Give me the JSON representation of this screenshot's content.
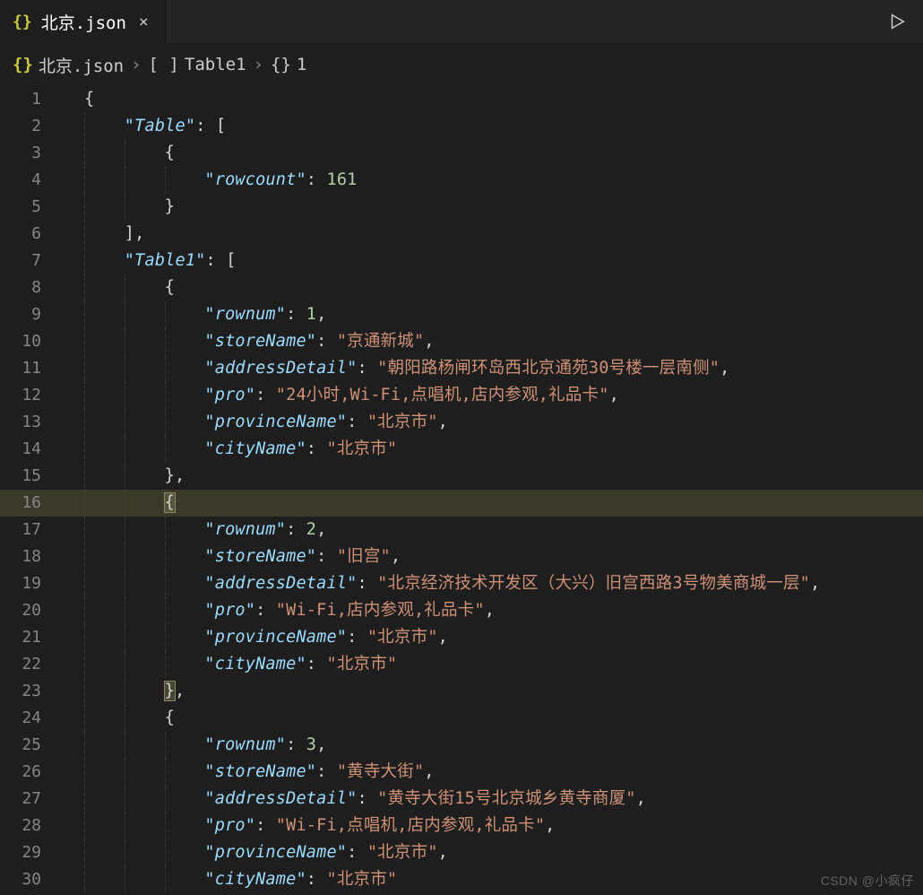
{
  "tab": {
    "file_icon": "{}",
    "filename": "北京.json",
    "close_label": "×"
  },
  "run": {
    "title": "run"
  },
  "breadcrumbs": {
    "file_icon": "{}",
    "file": "北京.json",
    "array_icon": "[ ]",
    "node1": "Table1",
    "object_icon": "{}",
    "node2": "1"
  },
  "code": {
    "indent_unit": 4,
    "lines": [
      {
        "n": 1,
        "indent": 0,
        "guides": [],
        "tokens": [
          {
            "t": "brace",
            "v": "{"
          }
        ]
      },
      {
        "n": 2,
        "indent": 1,
        "guides": [
          0
        ],
        "tokens": [
          {
            "t": "key",
            "v": "Table"
          },
          {
            "t": "punc",
            "v": ": "
          },
          {
            "t": "bracket",
            "v": "["
          }
        ]
      },
      {
        "n": 3,
        "indent": 2,
        "guides": [
          0,
          1
        ],
        "tokens": [
          {
            "t": "brace",
            "v": "{"
          }
        ]
      },
      {
        "n": 4,
        "indent": 3,
        "guides": [
          0,
          1,
          2
        ],
        "tokens": [
          {
            "t": "key",
            "v": "rowcount"
          },
          {
            "t": "punc",
            "v": ": "
          },
          {
            "t": "num",
            "v": "161"
          }
        ]
      },
      {
        "n": 5,
        "indent": 2,
        "guides": [
          0,
          1
        ],
        "tokens": [
          {
            "t": "brace",
            "v": "}"
          }
        ]
      },
      {
        "n": 6,
        "indent": 1,
        "guides": [
          0
        ],
        "tokens": [
          {
            "t": "bracket",
            "v": "]"
          },
          {
            "t": "punc",
            "v": ","
          }
        ]
      },
      {
        "n": 7,
        "indent": 1,
        "guides": [
          0
        ],
        "tokens": [
          {
            "t": "key",
            "v": "Table1"
          },
          {
            "t": "punc",
            "v": ": "
          },
          {
            "t": "bracket",
            "v": "["
          }
        ]
      },
      {
        "n": 8,
        "indent": 2,
        "guides": [
          0,
          1
        ],
        "tokens": [
          {
            "t": "brace",
            "v": "{"
          }
        ]
      },
      {
        "n": 9,
        "indent": 3,
        "guides": [
          0,
          1,
          2
        ],
        "tokens": [
          {
            "t": "key",
            "v": "rownum"
          },
          {
            "t": "punc",
            "v": ": "
          },
          {
            "t": "num",
            "v": "1"
          },
          {
            "t": "punc",
            "v": ","
          }
        ]
      },
      {
        "n": 10,
        "indent": 3,
        "guides": [
          0,
          1,
          2
        ],
        "tokens": [
          {
            "t": "key",
            "v": "storeName"
          },
          {
            "t": "punc",
            "v": ": "
          },
          {
            "t": "str",
            "v": "京通新城"
          },
          {
            "t": "punc",
            "v": ","
          }
        ]
      },
      {
        "n": 11,
        "indent": 3,
        "guides": [
          0,
          1,
          2
        ],
        "tokens": [
          {
            "t": "key",
            "v": "addressDetail"
          },
          {
            "t": "punc",
            "v": ": "
          },
          {
            "t": "str",
            "v": "朝阳路杨闸环岛西北京通苑30号楼一层南侧"
          },
          {
            "t": "punc",
            "v": ","
          }
        ]
      },
      {
        "n": 12,
        "indent": 3,
        "guides": [
          0,
          1,
          2
        ],
        "tokens": [
          {
            "t": "key",
            "v": "pro"
          },
          {
            "t": "punc",
            "v": ": "
          },
          {
            "t": "str",
            "v": "24小时,Wi-Fi,点唱机,店内参观,礼品卡"
          },
          {
            "t": "punc",
            "v": ","
          }
        ]
      },
      {
        "n": 13,
        "indent": 3,
        "guides": [
          0,
          1,
          2
        ],
        "tokens": [
          {
            "t": "key",
            "v": "provinceName"
          },
          {
            "t": "punc",
            "v": ": "
          },
          {
            "t": "str",
            "v": "北京市"
          },
          {
            "t": "punc",
            "v": ","
          }
        ]
      },
      {
        "n": 14,
        "indent": 3,
        "guides": [
          0,
          1,
          2
        ],
        "tokens": [
          {
            "t": "key",
            "v": "cityName"
          },
          {
            "t": "punc",
            "v": ": "
          },
          {
            "t": "str",
            "v": "北京市"
          }
        ]
      },
      {
        "n": 15,
        "indent": 2,
        "guides": [
          0,
          1
        ],
        "tokens": [
          {
            "t": "brace",
            "v": "}"
          },
          {
            "t": "punc",
            "v": ","
          }
        ]
      },
      {
        "n": 16,
        "indent": 2,
        "guides": [
          0,
          1
        ],
        "highlight": true,
        "tokens": [
          {
            "t": "match",
            "v": "{"
          }
        ]
      },
      {
        "n": 17,
        "indent": 3,
        "guides": [
          0,
          1,
          2
        ],
        "tokens": [
          {
            "t": "key",
            "v": "rownum"
          },
          {
            "t": "punc",
            "v": ": "
          },
          {
            "t": "num",
            "v": "2"
          },
          {
            "t": "punc",
            "v": ","
          }
        ]
      },
      {
        "n": 18,
        "indent": 3,
        "guides": [
          0,
          1,
          2
        ],
        "tokens": [
          {
            "t": "key",
            "v": "storeName"
          },
          {
            "t": "punc",
            "v": ": "
          },
          {
            "t": "str",
            "v": "旧宫"
          },
          {
            "t": "punc",
            "v": ","
          }
        ]
      },
      {
        "n": 19,
        "indent": 3,
        "guides": [
          0,
          1,
          2
        ],
        "tokens": [
          {
            "t": "key",
            "v": "addressDetail"
          },
          {
            "t": "punc",
            "v": ": "
          },
          {
            "t": "str",
            "v": "北京经济技术开发区（大兴）旧宫西路3号物美商城一层"
          },
          {
            "t": "punc",
            "v": ","
          }
        ]
      },
      {
        "n": 20,
        "indent": 3,
        "guides": [
          0,
          1,
          2
        ],
        "tokens": [
          {
            "t": "key",
            "v": "pro"
          },
          {
            "t": "punc",
            "v": ": "
          },
          {
            "t": "str",
            "v": "Wi-Fi,店内参观,礼品卡"
          },
          {
            "t": "punc",
            "v": ","
          }
        ]
      },
      {
        "n": 21,
        "indent": 3,
        "guides": [
          0,
          1,
          2
        ],
        "tokens": [
          {
            "t": "key",
            "v": "provinceName"
          },
          {
            "t": "punc",
            "v": ": "
          },
          {
            "t": "str",
            "v": "北京市"
          },
          {
            "t": "punc",
            "v": ","
          }
        ]
      },
      {
        "n": 22,
        "indent": 3,
        "guides": [
          0,
          1,
          2
        ],
        "tokens": [
          {
            "t": "key",
            "v": "cityName"
          },
          {
            "t": "punc",
            "v": ": "
          },
          {
            "t": "str",
            "v": "北京市"
          }
        ]
      },
      {
        "n": 23,
        "indent": 2,
        "guides": [
          0,
          1
        ],
        "tokens": [
          {
            "t": "match",
            "v": "}"
          },
          {
            "t": "punc",
            "v": ","
          }
        ]
      },
      {
        "n": 24,
        "indent": 2,
        "guides": [
          0,
          1
        ],
        "tokens": [
          {
            "t": "brace",
            "v": "{"
          }
        ]
      },
      {
        "n": 25,
        "indent": 3,
        "guides": [
          0,
          1,
          2
        ],
        "tokens": [
          {
            "t": "key",
            "v": "rownum"
          },
          {
            "t": "punc",
            "v": ": "
          },
          {
            "t": "num",
            "v": "3"
          },
          {
            "t": "punc",
            "v": ","
          }
        ]
      },
      {
        "n": 26,
        "indent": 3,
        "guides": [
          0,
          1,
          2
        ],
        "tokens": [
          {
            "t": "key",
            "v": "storeName"
          },
          {
            "t": "punc",
            "v": ": "
          },
          {
            "t": "str",
            "v": "黄寺大街"
          },
          {
            "t": "punc",
            "v": ","
          }
        ]
      },
      {
        "n": 27,
        "indent": 3,
        "guides": [
          0,
          1,
          2
        ],
        "tokens": [
          {
            "t": "key",
            "v": "addressDetail"
          },
          {
            "t": "punc",
            "v": ": "
          },
          {
            "t": "str",
            "v": "黄寺大街15号北京城乡黄寺商厦"
          },
          {
            "t": "punc",
            "v": ","
          }
        ]
      },
      {
        "n": 28,
        "indent": 3,
        "guides": [
          0,
          1,
          2
        ],
        "tokens": [
          {
            "t": "key",
            "v": "pro"
          },
          {
            "t": "punc",
            "v": ": "
          },
          {
            "t": "str",
            "v": "Wi-Fi,点唱机,店内参观,礼品卡"
          },
          {
            "t": "punc",
            "v": ","
          }
        ]
      },
      {
        "n": 29,
        "indent": 3,
        "guides": [
          0,
          1,
          2
        ],
        "tokens": [
          {
            "t": "key",
            "v": "provinceName"
          },
          {
            "t": "punc",
            "v": ": "
          },
          {
            "t": "str",
            "v": "北京市"
          },
          {
            "t": "punc",
            "v": ","
          }
        ]
      },
      {
        "n": 30,
        "indent": 3,
        "guides": [
          0,
          1,
          2
        ],
        "tokens": [
          {
            "t": "key",
            "v": "cityName"
          },
          {
            "t": "punc",
            "v": ": "
          },
          {
            "t": "str",
            "v": "北京市"
          }
        ]
      }
    ]
  },
  "watermark": "CSDN @小疯仔"
}
